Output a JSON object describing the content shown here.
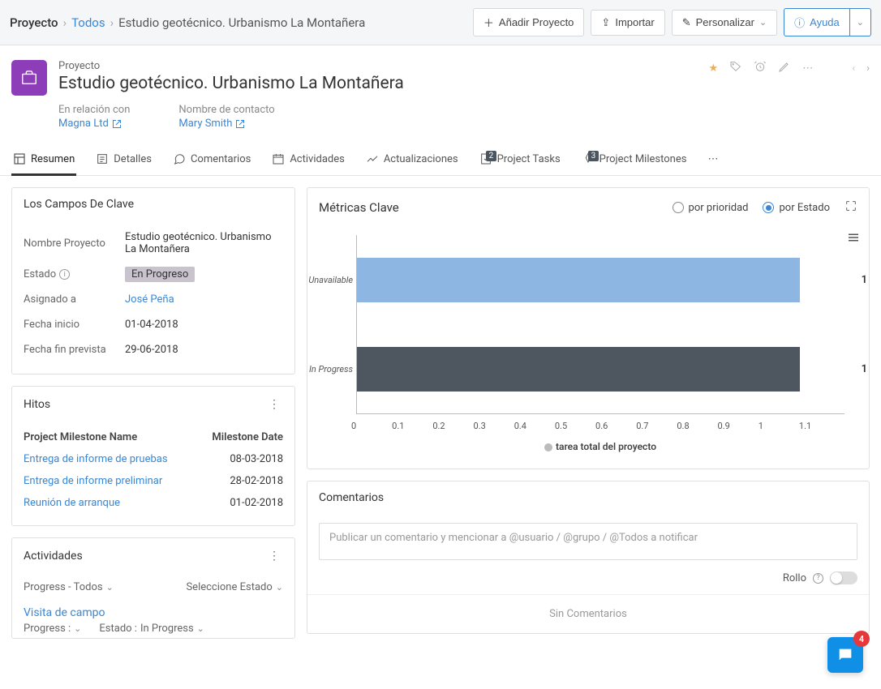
{
  "breadcrumb": {
    "root": "Proyecto",
    "mid": "Todos",
    "leaf": "Estudio geotécnico. Urbanismo La Montañera"
  },
  "topbar": {
    "add": "Añadir Proyecto",
    "import": "Importar",
    "customize": "Personalizar",
    "help": "Ayuda"
  },
  "header": {
    "label": "Proyecto",
    "title": "Estudio geotécnico. Urbanismo La Montañera"
  },
  "relations": {
    "rel1_label": "En relación con",
    "rel1_value": "Magna Ltd",
    "rel2_label": "Nombre de contacto",
    "rel2_value": "Mary Smith"
  },
  "tabs": {
    "summary": "Resumen",
    "details": "Detalles",
    "comments": "Comentarios",
    "activities": "Actividades",
    "updates": "Actualizaciones",
    "tasks": "Project Tasks",
    "tasks_badge": "2",
    "milestones": "Project Milestones",
    "milestones_badge": "3"
  },
  "keyfields": {
    "title": "Los Campos De Clave",
    "name_lbl": "Nombre Proyecto",
    "name_val": "Estudio geotécnico. Urbanismo La Montañera",
    "status_lbl": "Estado",
    "status_val": "En Progreso",
    "assigned_lbl": "Asignado a",
    "assigned_val": "José Peña",
    "start_lbl": "Fecha inicio",
    "start_val": "01-04-2018",
    "end_lbl": "Fecha fin prevista",
    "end_val": "29-06-2018"
  },
  "milestones": {
    "title": "Hitos",
    "col_name": "Project Milestone Name",
    "col_date": "Milestone Date",
    "rows": [
      {
        "name": "Entrega de informe de pruebas",
        "date": "08-03-2018"
      },
      {
        "name": "Entrega de informe preliminar",
        "date": "28-02-2018"
      },
      {
        "name": "Reunión de arranque",
        "date": "01-02-2018"
      }
    ]
  },
  "activities": {
    "title": "Actividades",
    "filter1": "Progress - Todos",
    "filter2": "Seleccione Estado",
    "item_title": "Visita de campo",
    "item_progress_lbl": "Progress :",
    "item_state_lbl": "Estado :",
    "item_state_val": "In Progress"
  },
  "metrics": {
    "title": "Métricas Clave",
    "radio1": "por prioridad",
    "radio2": "por Estado",
    "legend": "tarea total del proyecto"
  },
  "chart_data": {
    "type": "bar",
    "orientation": "horizontal",
    "categories": [
      "Unavailable",
      "In Progress"
    ],
    "values": [
      1,
      1
    ],
    "colors": [
      "#8db7e2",
      "#4e5660"
    ],
    "xlim": [
      0,
      1.1
    ],
    "xticks": [
      "0",
      "0.1",
      "0.2",
      "0.3",
      "0.4",
      "0.5",
      "0.6",
      "0.7",
      "0.8",
      "0.9",
      "1",
      "1.1"
    ],
    "xlabel": "",
    "ylabel": "",
    "legend": "tarea total del proyecto"
  },
  "comments": {
    "title": "Comentarios",
    "placeholder": "Publicar un comentario y mencionar a @usuario / @grupo / @Todos a notificar",
    "rollo": "Rollo",
    "empty": "Sin Comentarios"
  },
  "chat": {
    "badge": "4"
  }
}
